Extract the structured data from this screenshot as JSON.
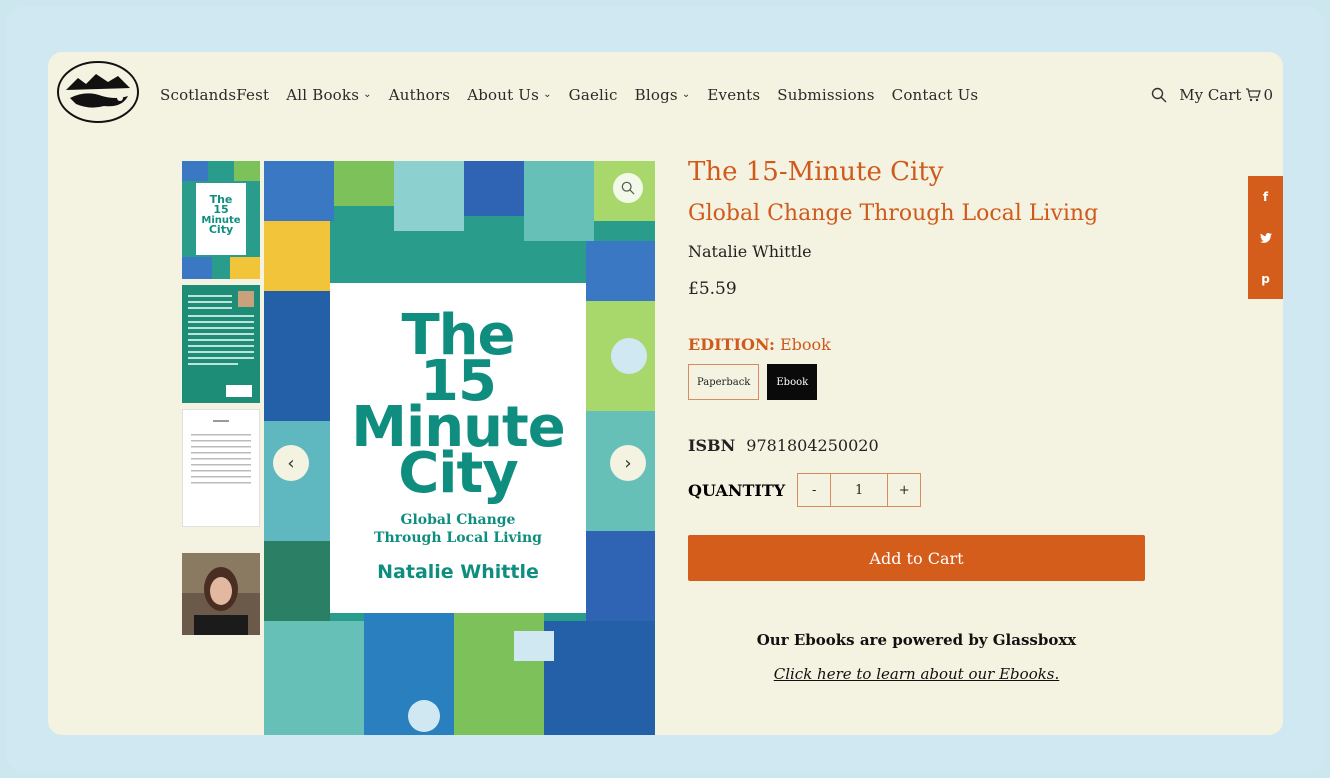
{
  "header": {
    "logo_alt": "logo",
    "nav": [
      {
        "label": "ScotlandsFest",
        "dropdown": false
      },
      {
        "label": "All Books",
        "dropdown": true
      },
      {
        "label": "Authors",
        "dropdown": false
      },
      {
        "label": "About Us",
        "dropdown": true
      },
      {
        "label": "Gaelic",
        "dropdown": false
      },
      {
        "label": "Blogs",
        "dropdown": true
      },
      {
        "label": "Events",
        "dropdown": false
      },
      {
        "label": "Submissions",
        "dropdown": false
      },
      {
        "label": "Contact Us",
        "dropdown": false
      }
    ],
    "cart_label": "My Cart",
    "cart_count": "0"
  },
  "gallery": {
    "cover": {
      "title_line1": "The",
      "title_line2": "15",
      "title_line3": "Minute",
      "title_line4": "City",
      "subtitle_line1": "Global Change",
      "subtitle_line2": "Through Local Living",
      "author": "Natalie Whittle"
    },
    "prev_arrow": "‹",
    "next_arrow": "›"
  },
  "product": {
    "title": "The 15-Minute City",
    "subtitle": "Global Change Through Local Living",
    "author": "Natalie Whittle",
    "price": "£5.59",
    "edition_label": "EDITION:",
    "edition_value": "Ebook",
    "editions": [
      "Paperback",
      "Ebook"
    ],
    "isbn_label": "ISBN",
    "isbn": "9781804250020",
    "quantity_label": "QUANTITY",
    "qty_minus": "-",
    "quantity": "1",
    "qty_plus": "+",
    "add_to_cart": "Add to Cart",
    "ebook_note": "Our Ebooks are powered by Glassboxx",
    "ebook_link": "Click here to learn about our Ebooks."
  },
  "social": {
    "facebook": "f",
    "twitter": "t",
    "pinterest": "p"
  },
  "colors": {
    "accent": "#d45d1c",
    "page_bg": "#f4f2e0",
    "frame_bg": "#cde7ef",
    "cover_teal": "#0f8e80"
  }
}
